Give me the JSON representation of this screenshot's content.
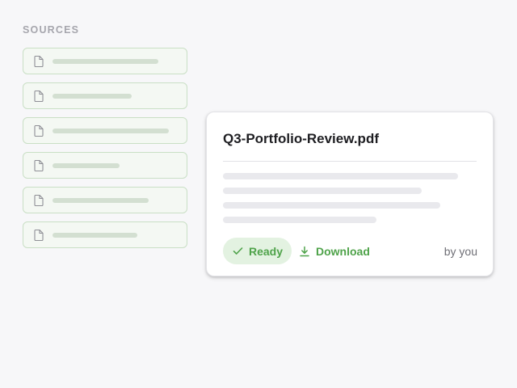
{
  "sources": {
    "heading": "SOURCES",
    "items": [
      {
        "icon": "file-icon",
        "placeholder_fraction": 0.87
      },
      {
        "icon": "file-icon",
        "placeholder_fraction": 0.65
      },
      {
        "icon": "file-icon",
        "placeholder_fraction": 0.96
      },
      {
        "icon": "file-icon",
        "placeholder_fraction": 0.55
      },
      {
        "icon": "file-icon",
        "placeholder_fraction": 0.79
      },
      {
        "icon": "file-icon",
        "placeholder_fraction": 0.7
      }
    ]
  },
  "card": {
    "title": "Q3-Portfolio-Review.pdf",
    "preview_line_fractions": [
      0.92,
      0.78,
      0.85,
      0.6
    ],
    "status": {
      "icon": "check-icon",
      "label": "Ready"
    },
    "download": {
      "icon": "download-icon",
      "label": "Download"
    },
    "byline": "by you"
  },
  "colors": {
    "background": "#f7f7f9",
    "accent_green": "#4fa34a",
    "badge_background": "#e3f2e1",
    "source_border": "#c9dfc5",
    "source_background": "#f4f8f3",
    "file_icon": "#8f8f96"
  }
}
